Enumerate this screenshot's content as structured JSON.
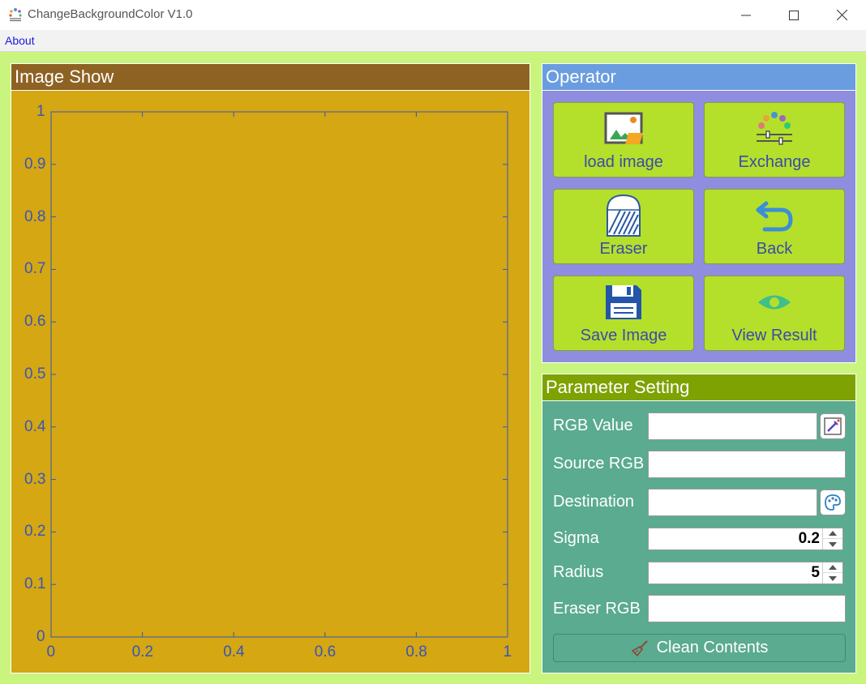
{
  "window": {
    "title": "ChangeBackgroundColor V1.0",
    "app_icon": "palette-app-icon",
    "controls": [
      "minimize-icon",
      "maximize-icon",
      "close-icon"
    ]
  },
  "menu": {
    "items": [
      "About"
    ]
  },
  "image_show": {
    "title": "Image Show",
    "plot": {
      "x_ticks": [
        "0",
        "0.2",
        "0.4",
        "0.6",
        "0.8",
        "1"
      ],
      "y_ticks": [
        "0",
        "0.1",
        "0.2",
        "0.3",
        "0.4",
        "0.5",
        "0.6",
        "0.7",
        "0.8",
        "0.9",
        "1"
      ],
      "xlim": [
        0,
        1
      ],
      "ylim": [
        0,
        1
      ]
    }
  },
  "operator": {
    "title": "Operator",
    "buttons": [
      {
        "label": "load image",
        "icon": "image-folder-icon"
      },
      {
        "label": "Exchange",
        "icon": "color-adjust-icon"
      },
      {
        "label": "Eraser",
        "icon": "eraser-icon"
      },
      {
        "label": "Back",
        "icon": "undo-arrow-icon"
      },
      {
        "label": "Save Image",
        "icon": "floppy-disk-icon"
      },
      {
        "label": "View Result",
        "icon": "eye-icon"
      }
    ]
  },
  "parameters": {
    "title": "Parameter Setting",
    "rgb_value": {
      "label": "RGB Value",
      "value": "",
      "button_icon": "color-picker-icon"
    },
    "source_rgb": {
      "label": "Source RGB",
      "value": ""
    },
    "destination": {
      "label": "Destination",
      "value": "",
      "button_icon": "palette-icon"
    },
    "sigma": {
      "label": "Sigma",
      "value": "0.2"
    },
    "radius": {
      "label": "Radius",
      "value": "5"
    },
    "eraser_rgb": {
      "label": "Eraser RGB",
      "value": ""
    },
    "clean_button": {
      "label": "Clean Contents",
      "icon": "broom-icon"
    }
  },
  "colors": {
    "background": "#c9f57f",
    "image_panel_bg": "#d4a713",
    "image_header": "#8e6222",
    "operator_bg": "#8e8de0",
    "operator_header": "#6a9de0",
    "button_bg": "#b4e02b",
    "button_text": "#3b4ba8",
    "param_bg": "#5aab8f",
    "param_header": "#7ea202",
    "axis": "#3955b8"
  }
}
